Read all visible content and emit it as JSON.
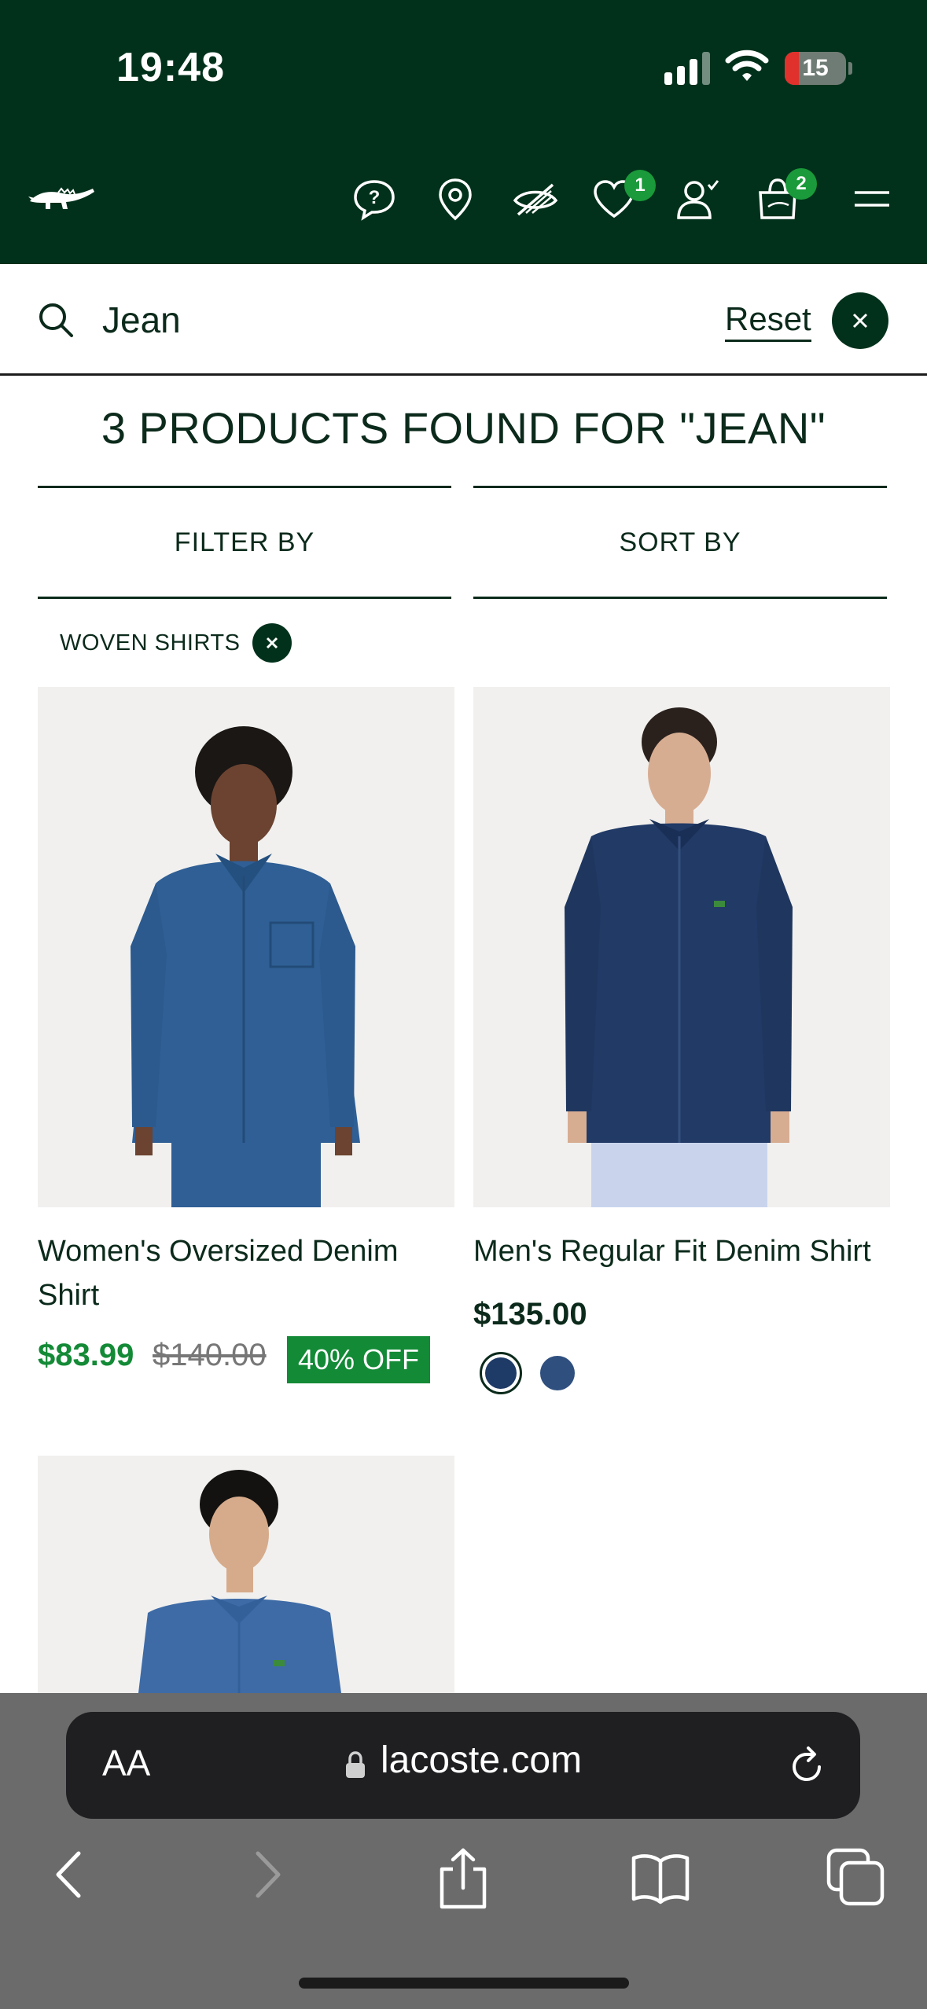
{
  "status_bar": {
    "time": "19:48",
    "battery": "15"
  },
  "header": {
    "brand": "lacoste-logo",
    "icons": [
      "help-icon",
      "store-locator-icon",
      "accessibility-icon",
      "wishlist-icon",
      "account-icon",
      "cart-icon",
      "menu-icon"
    ],
    "wishlist_count": "1",
    "cart_count": "2"
  },
  "search": {
    "value": "Jean",
    "reset_label": "Reset"
  },
  "results": {
    "title": "3 PRODUCTS FOUND FOR \"JEAN\"",
    "filter_label": "FILTER BY",
    "sort_label": "SORT BY",
    "active_filter": "WOVEN SHIRTS"
  },
  "products": [
    {
      "name": "Women's Oversized Denim Shirt",
      "sale_price": "$83.99",
      "original_price": "$140.00",
      "discount": "40% OFF"
    },
    {
      "name": "Men's Regular Fit Denim Shirt",
      "price": "$135.00",
      "swatches": [
        "#1e3a66",
        "#2f4f7f"
      ]
    },
    {
      "name": ""
    }
  ],
  "browser": {
    "aa_label": "AA",
    "url": "lacoste.com"
  },
  "colors": {
    "brand_green": "#01311b",
    "sale_green": "#138a36",
    "badge_green": "#1a9a3a"
  }
}
